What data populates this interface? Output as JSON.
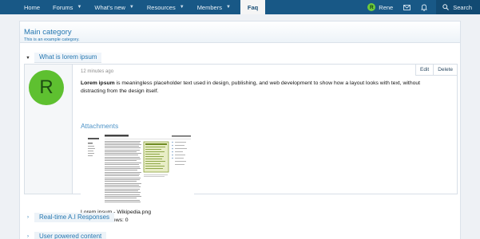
{
  "nav": {
    "items": [
      {
        "label": "Home",
        "has_menu": false
      },
      {
        "label": "Forums",
        "has_menu": true
      },
      {
        "label": "What's new",
        "has_menu": true
      },
      {
        "label": "Resources",
        "has_menu": true
      },
      {
        "label": "Members",
        "has_menu": true
      }
    ],
    "active_label": "Faq",
    "user_name": "Rene",
    "user_initial": "R",
    "search_label": "Search",
    "icons": [
      "mail-icon",
      "bell-icon",
      "search-icon"
    ]
  },
  "category": {
    "title": "Main category",
    "description": "This is an example category."
  },
  "faq": {
    "open_item": {
      "question": "What is lorem ipsum",
      "time": "12 minutes ago",
      "author_initial": "R",
      "actions": {
        "edit": "Edit",
        "delete": "Delete"
      },
      "body_bold": "Lorem ipsum",
      "body_rest": " is meaningless placeholder text used in design, publishing, and web development to show how a layout looks with text, without distracting from the design itself.",
      "attachments_title": "Attachments",
      "attachment": {
        "name": "Lorem ipsum - Wikipedia.png",
        "meta": "255.7 KB · Views: 0"
      }
    },
    "collapsed_items": [
      "Real-time A.I Responses",
      "User powered content"
    ]
  },
  "colors": {
    "nav_bg": "#185886",
    "accent": "#2577b1",
    "avatar_bg": "#5ec030"
  }
}
